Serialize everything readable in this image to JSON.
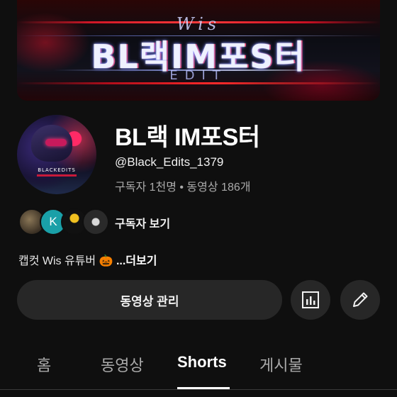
{
  "banner": {
    "top_text": "Wis",
    "title": "BL랙IM포S터",
    "sub_text": "EDIT"
  },
  "channel": {
    "name": "BL랙 IM포S터",
    "handle": "@Black_Edits_1379",
    "stats": "구독자 1천명 • 동영상 186개",
    "avatar_text": "BLACKEDITS"
  },
  "subscribers": {
    "avatar_k": "K",
    "label": "구독자 보기"
  },
  "description": {
    "text": "캡컷 Wis 유튜버 🎃 ",
    "more": "...더보기"
  },
  "actions": {
    "manage_label": "동영상 관리",
    "analytics_icon": "bar-chart-icon",
    "edit_icon": "pencil-icon"
  },
  "tabs": [
    {
      "label": "홈"
    },
    {
      "label": "동영상"
    },
    {
      "label": "Shorts",
      "active": true
    },
    {
      "label": "게시물"
    }
  ],
  "colors": {
    "background": "#0f0f0f",
    "button": "#272727",
    "secondary_text": "#aaaaaa",
    "accent_red": "#d01626"
  }
}
